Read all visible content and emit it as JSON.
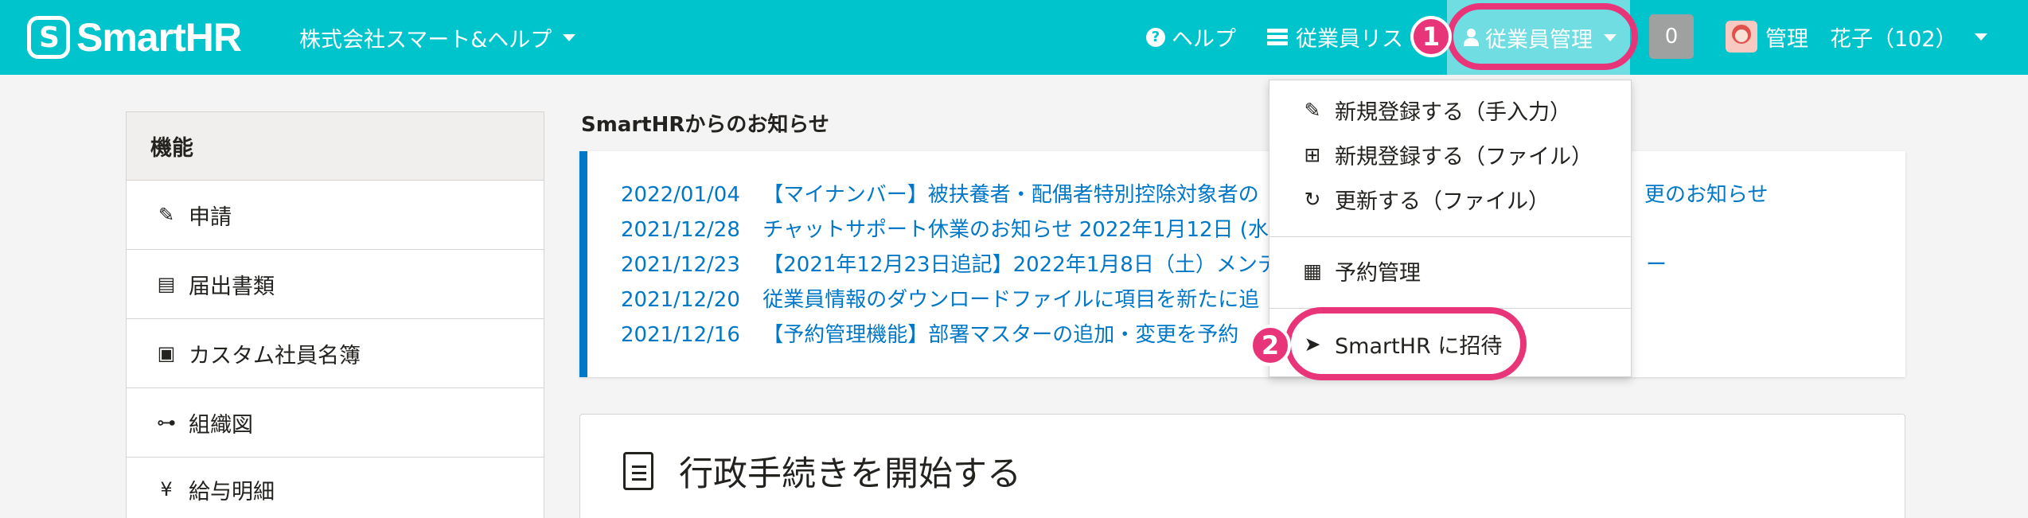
{
  "header": {
    "logo_text": "SmartHR",
    "logo_mark": "S",
    "company": "株式会社スマート&ヘルプ",
    "help_label": "ヘルプ",
    "employee_list_label": "従業員リス",
    "employee_manage_label": "従業員管理",
    "notification_count": "0",
    "user_label": "管理　花子（102）"
  },
  "sidebar": {
    "heading": "機能",
    "items": [
      {
        "label": "申請",
        "icon": "request-icon"
      },
      {
        "label": "届出書類",
        "icon": "document-icon"
      },
      {
        "label": "カスタム社員名簿",
        "icon": "contact-book-icon"
      },
      {
        "label": "組織図",
        "icon": "org-chart-icon"
      },
      {
        "label": "給与明細",
        "icon": "payslip-icon"
      }
    ]
  },
  "notices": {
    "title": "SmartHRからのお知らせ",
    "items": [
      {
        "date": "2022/01/04",
        "text": "【マイナンバー】被扶養者・配偶者特別控除対象者の"
      },
      {
        "date": "2021/12/28",
        "text": "チャットサポート休業のお知らせ 2022年1月12日 (水"
      },
      {
        "date": "2021/12/23",
        "text": "【2021年12月23日追記】2022年1月8日（土）メンテ"
      },
      {
        "date": "2021/12/20",
        "text": "従業員情報のダウンロードファイルに項目を新たに追"
      },
      {
        "date": "2021/12/16",
        "text": "【予約管理機能】部署マスターの追加・変更を予約"
      }
    ],
    "first_suffix": "更のお知らせ",
    "third_suffix": "ー"
  },
  "procedure": {
    "title": "行政手続きを開始する"
  },
  "dropdown": {
    "items": [
      {
        "label": "新規登録する（手入力）",
        "icon": "edit-icon"
      },
      {
        "label": "新規登録する（ファイル）",
        "icon": "file-add-icon"
      },
      {
        "label": "更新する（ファイル）",
        "icon": "file-refresh-icon"
      },
      {
        "label": "予約管理",
        "icon": "calendar-icon"
      },
      {
        "label": "SmartHR に招待",
        "icon": "send-icon"
      }
    ]
  },
  "markers": {
    "one": "1",
    "two": "2"
  },
  "colors": {
    "header_bg": "#00c4cc",
    "active_nav_bg": "#6fdde1",
    "link": "#0077c7",
    "highlight": "#e8357a"
  }
}
